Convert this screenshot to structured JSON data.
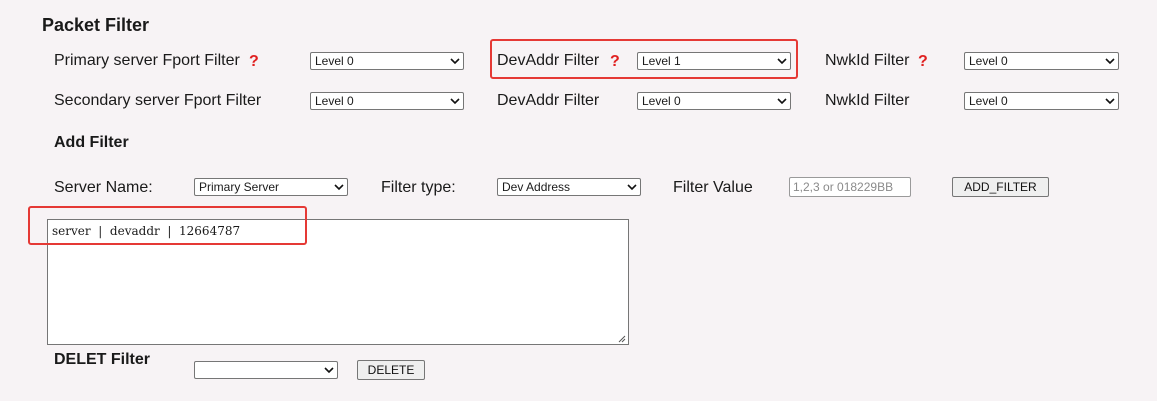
{
  "page": {
    "title": "Packet Filter"
  },
  "filters": {
    "primary_row": {
      "fport_label": "Primary server Fport Filter",
      "fport_value": "Level 0",
      "devaddr_label": "DevAddr Filter",
      "devaddr_value": "Level 1",
      "nwkid_label": "NwkId Filter",
      "nwkid_value": "Level 0"
    },
    "secondary_row": {
      "fport_label": "Secondary server Fport Filter",
      "fport_value": "Level 0",
      "devaddr_label": "DevAddr Filter",
      "devaddr_value": "Level 0",
      "nwkid_label": "NwkId Filter",
      "nwkid_value": "Level 0"
    },
    "help_glyph": "?"
  },
  "add_filter": {
    "heading": "Add Filter",
    "server_name_label": "Server Name:",
    "server_name_value": "Primary Server",
    "filter_type_label": "Filter type:",
    "filter_type_value": "Dev Address",
    "filter_value_label": "Filter Value",
    "filter_value_placeholder": "1,2,3 or 018229BB",
    "add_button": "ADD_FILTER"
  },
  "filter_list": {
    "content": "server  |  devaddr  |  12664787"
  },
  "delete_filter": {
    "heading": "DELET Filter",
    "select_value": "",
    "delete_button": "DELETE"
  },
  "colors": {
    "highlight": "#e53935",
    "help_icon": "#e02020",
    "panel_bg": "#f7f3f5"
  }
}
